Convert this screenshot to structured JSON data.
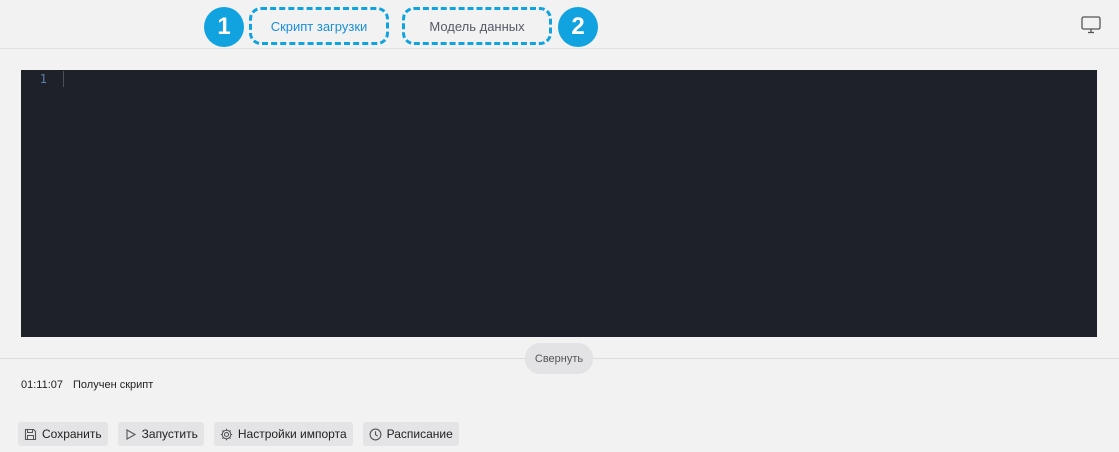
{
  "header": {
    "badges": [
      "1",
      "2"
    ],
    "tabs": [
      {
        "label": "Скрипт загрузки",
        "active": true
      },
      {
        "label": "Модель данных",
        "active": false
      }
    ],
    "right_icon": "monitor-icon",
    "accent_color": "#11a3e0"
  },
  "editor": {
    "line_numbers": [
      "1"
    ],
    "background": "#1e2127"
  },
  "collapse": {
    "label": "Свернуть"
  },
  "log": {
    "time": "01:11:07",
    "message": "Получен скрипт"
  },
  "toolbar": {
    "save": {
      "label": "Сохранить",
      "icon": "floppy-disk-icon"
    },
    "run": {
      "label": "Запустить",
      "icon": "play-icon"
    },
    "import_settings": {
      "label": "Настройки импорта",
      "icon": "gear-icon"
    },
    "schedule": {
      "label": "Расписание",
      "icon": "clock-icon"
    }
  }
}
